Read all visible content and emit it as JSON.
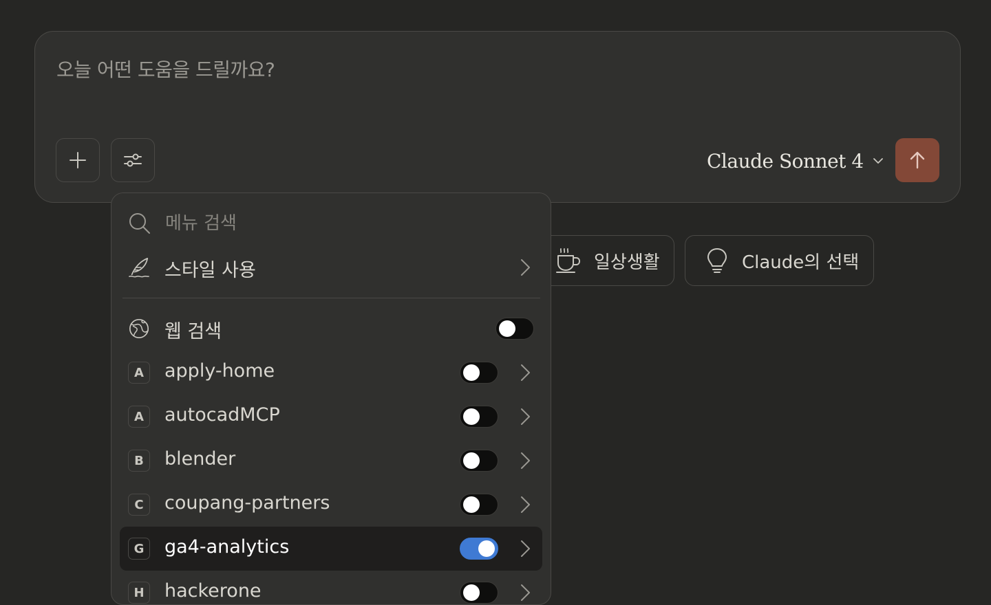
{
  "composer": {
    "placeholder": "오늘 어떤 도움을 드릴까요?",
    "model": "Claude Sonnet 4"
  },
  "chips": {
    "daily": "일상생활",
    "pick": "Claude의 선택"
  },
  "menu": {
    "search_placeholder": "메뉴 검색",
    "style_label": "스타일 사용",
    "web_search_label": "웹 검색",
    "web_search_enabled": false,
    "connectors": [
      {
        "letter": "A",
        "name": "apply-home",
        "enabled": false
      },
      {
        "letter": "A",
        "name": "autocadMCP",
        "enabled": false
      },
      {
        "letter": "B",
        "name": "blender",
        "enabled": false
      },
      {
        "letter": "C",
        "name": "coupang-partners",
        "enabled": false
      },
      {
        "letter": "G",
        "name": "ga4-analytics",
        "enabled": true
      },
      {
        "letter": "H",
        "name": "hackerone",
        "enabled": false
      }
    ]
  },
  "colors": {
    "background": "#262624",
    "send_button": "#834837",
    "toggle_on": "#3f7ad3"
  }
}
